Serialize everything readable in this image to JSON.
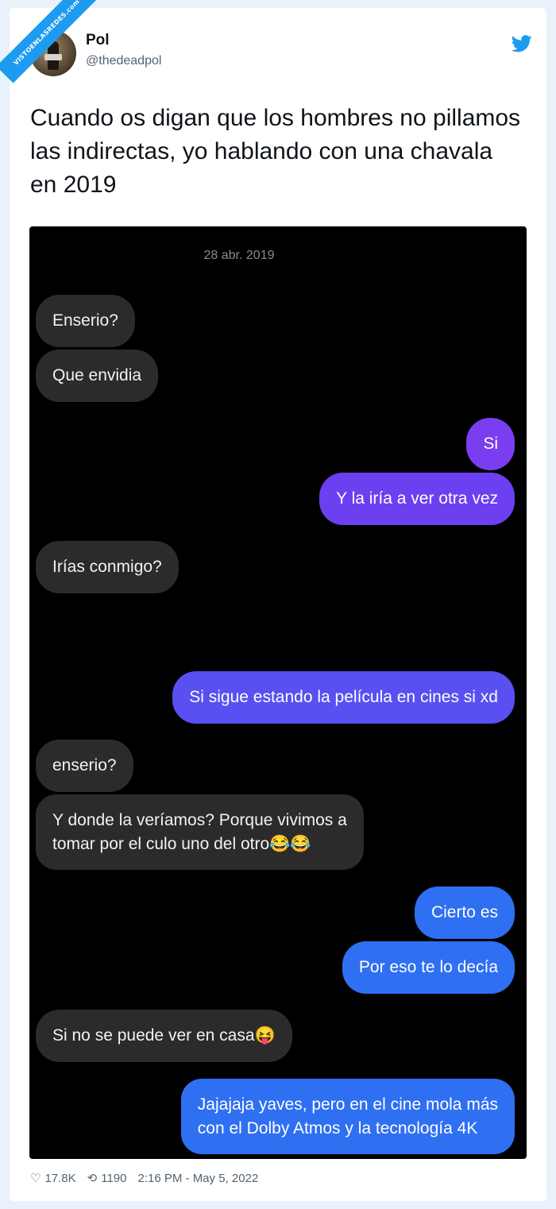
{
  "watermark": {
    "text": "VISTOENLASREDES",
    "sub": ".com"
  },
  "author": {
    "name": "Pol",
    "handle": "@thedeadpol"
  },
  "tweet": {
    "text": "Cuando os digan que los hombres no pillamos las indirectas, yo hablando con una chavala en 2019"
  },
  "chat": {
    "date": "28 abr. 2019",
    "messages": [
      {
        "side": "in",
        "text": "Enserio?"
      },
      {
        "side": "in",
        "text": "Que envidia"
      },
      {
        "side": "out",
        "color": "#7a3df0",
        "text": "Si"
      },
      {
        "side": "out",
        "color": "#7a3df0",
        "text": "Y la iría a ver otra vez"
      },
      {
        "side": "in",
        "text": "Irías conmigo?"
      },
      {
        "side": "in",
        "text": "😋"
      },
      {
        "side": "out",
        "color": "#5a4ff0",
        "text": "Si sigue estando la película en cines si xd"
      },
      {
        "side": "in",
        "text": "enserio?"
      },
      {
        "side": "in",
        "text": "Y donde la veríamos? Porque vivimos a\ntomar por el culo uno del otro😂😂"
      },
      {
        "side": "out",
        "color": "#2f6ff2",
        "text": "Cierto es"
      },
      {
        "side": "out",
        "color": "#2f6ff2",
        "text": "Por eso te lo decía"
      },
      {
        "side": "in",
        "text": "Si no se puede ver en casa😝"
      },
      {
        "side": "out",
        "color": "#2f6ff2",
        "text": "Jajajaja yaves, pero en el cine mola más\ncon el Dolby Atmos y la tecnología 4K"
      }
    ]
  },
  "footer": {
    "likes": "17.8K",
    "retweets": "1190",
    "timestamp": "2:16 PM - May 5, 2022"
  },
  "icons": {
    "heart": "heart-icon",
    "retweet": "retweet-icon",
    "bird": "twitter-bird-icon"
  }
}
